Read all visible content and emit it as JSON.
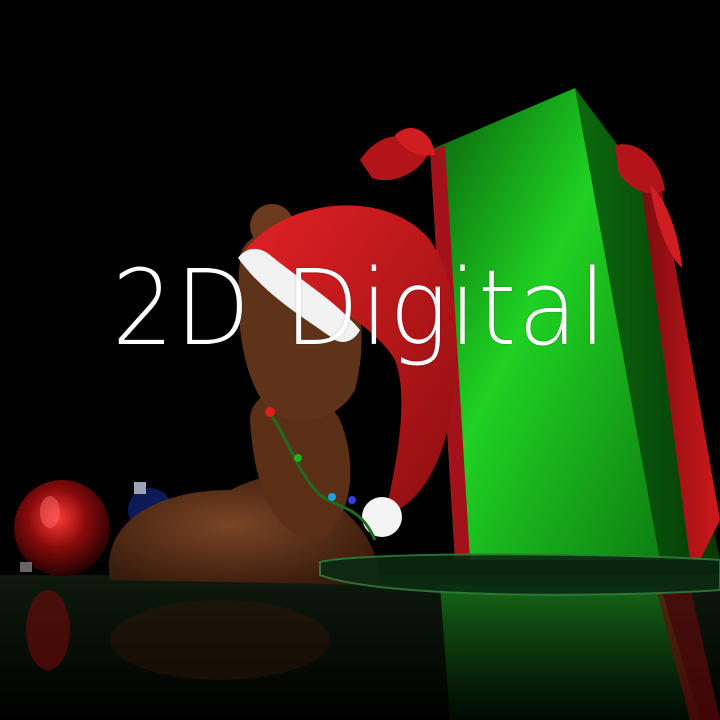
{
  "title": "2D Digital",
  "colors": {
    "background": "#000000",
    "gift_box": "#19c21c",
    "ribbon": "#c9161b",
    "hat": "#d11a1d",
    "bear_fur": "#6b3a1e",
    "text": "#ffffff"
  }
}
